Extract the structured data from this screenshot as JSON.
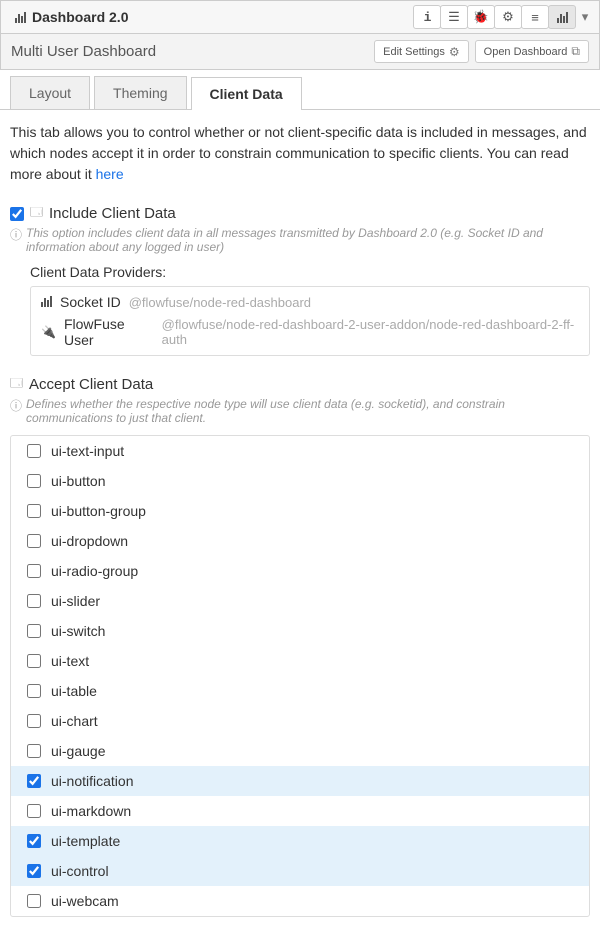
{
  "header": {
    "title": "Dashboard 2.0",
    "icons": [
      "info",
      "book",
      "debug",
      "gear",
      "layers",
      "chart",
      "caret"
    ]
  },
  "subheader": {
    "title": "Multi User Dashboard",
    "edit_button": "Edit Settings",
    "open_button": "Open Dashboard"
  },
  "tabs": [
    {
      "label": "Layout",
      "active": false
    },
    {
      "label": "Theming",
      "active": false
    },
    {
      "label": "Client Data",
      "active": true
    }
  ],
  "desc_text": "This tab allows you to control whether or not client-specific data is included in messages, and which nodes accept it in order to constrain communication to specific clients. You can read more about it ",
  "desc_link": "here",
  "include": {
    "label": "Include Client Data",
    "checked": true,
    "help": "This option includes client data in all messages transmitted by Dashboard 2.0 (e.g. Socket ID and information about any logged in user)"
  },
  "providers_label": "Client Data Providers:",
  "providers": [
    {
      "name": "Socket ID",
      "path": "@flowfuse/node-red-dashboard",
      "icon": "chart"
    },
    {
      "name": "FlowFuse User",
      "path": "@flowfuse/node-red-dashboard-2-user-addon/node-red-dashboard-2-ff-auth",
      "icon": "plug"
    }
  ],
  "accept": {
    "label": "Accept Client Data",
    "help": "Defines whether the respective node type will use client data (e.g. socketid), and constrain communications to just that client."
  },
  "nodes": [
    {
      "name": "ui-text-input",
      "checked": false
    },
    {
      "name": "ui-button",
      "checked": false
    },
    {
      "name": "ui-button-group",
      "checked": false
    },
    {
      "name": "ui-dropdown",
      "checked": false
    },
    {
      "name": "ui-radio-group",
      "checked": false
    },
    {
      "name": "ui-slider",
      "checked": false
    },
    {
      "name": "ui-switch",
      "checked": false
    },
    {
      "name": "ui-text",
      "checked": false
    },
    {
      "name": "ui-table",
      "checked": false
    },
    {
      "name": "ui-chart",
      "checked": false
    },
    {
      "name": "ui-gauge",
      "checked": false
    },
    {
      "name": "ui-notification",
      "checked": true
    },
    {
      "name": "ui-markdown",
      "checked": false
    },
    {
      "name": "ui-template",
      "checked": true
    },
    {
      "name": "ui-control",
      "checked": true
    },
    {
      "name": "ui-webcam",
      "checked": false
    }
  ]
}
